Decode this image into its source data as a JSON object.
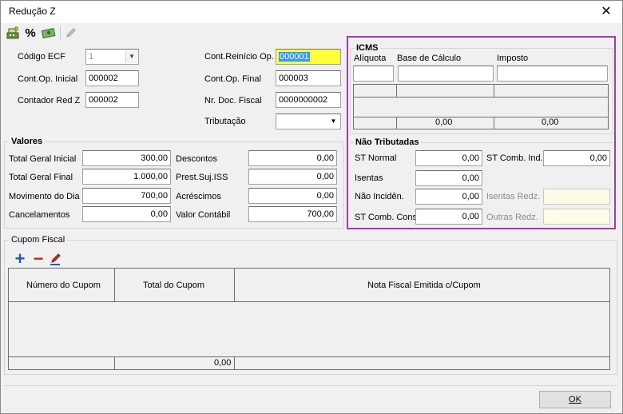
{
  "window": {
    "title": "Redução Z",
    "close_glyph": "✕"
  },
  "toolbar": {
    "icons": [
      "cash-register-icon",
      "percent-icon",
      "money-icon",
      "pencil-icon"
    ],
    "percent_glyph": "%"
  },
  "ecf": {
    "codigo_ecf_label": "Código ECF",
    "codigo_ecf_value": "1",
    "cont_op_inicial_label": "Cont.Op. Inicial",
    "cont_op_inicial_value": "000002",
    "contador_red_z_label": "Contador Red Z",
    "contador_red_z_value": "000002",
    "cont_reinicio_label": "Cont.Reinício Op.",
    "cont_reinicio_value": "000001",
    "cont_op_final_label": "Cont.Op. Final",
    "cont_op_final_value": "000003",
    "nr_doc_fiscal_label": "Nr. Doc. Fiscal",
    "nr_doc_fiscal_value": "0000000002",
    "tributacao_label": "Tributação",
    "tributacao_value": ""
  },
  "valores": {
    "title": "Valores",
    "total_geral_inicial_label": "Total Geral Inicial",
    "total_geral_inicial_value": "300,00",
    "total_geral_final_label": "Total Geral Final",
    "total_geral_final_value": "1.000,00",
    "movimento_dia_label": "Movimento do Dia",
    "movimento_dia_value": "700,00",
    "cancelamentos_label": "Cancelamentos",
    "cancelamentos_value": "0,00",
    "descontos_label": "Descontos",
    "descontos_value": "0,00",
    "prest_suj_iss_label": "Prest.Suj.ISS",
    "prest_suj_iss_value": "0,00",
    "acrescimos_label": "Acréscimos",
    "acrescimos_value": "0,00",
    "valor_contabil_label": "Valor Contábil",
    "valor_contabil_value": "700,00"
  },
  "icms": {
    "title": "ICMS",
    "aliquota_label": "Alíquota",
    "aliquota_value": "",
    "base_calculo_label": "Base de Cálculo",
    "base_calculo_value": "",
    "imposto_label": "Imposto",
    "imposto_value": "",
    "total_base": "0,00",
    "total_imposto": "0,00"
  },
  "nao_tributadas": {
    "title": "Não Tributadas",
    "st_normal_label": "ST Normal",
    "st_normal_value": "0,00",
    "isentas_label": "Isentas",
    "isentas_value": "0,00",
    "nao_incidencia_label": "Não Incidên.",
    "nao_incidencia_value": "0,00",
    "st_comb_cons_label": "ST Comb. Cons",
    "st_comb_cons_value": "0,00",
    "st_comb_ind_label": "ST Comb. Ind.",
    "st_comb_ind_value": "0,00",
    "isentas_redz_label": "Isentas Redz.",
    "isentas_redz_value": "",
    "outras_redz_label": "Outras Redz.",
    "outras_redz_value": ""
  },
  "cupom": {
    "title": "Cupom Fiscal",
    "columns": [
      "Número do Cupom",
      "Total do Cupom",
      "Nota Fiscal Emitida c/Cupom"
    ],
    "total": "0,00",
    "add_glyph": "+",
    "remove_glyph": "−"
  },
  "footer": {
    "ok_label": "OK"
  },
  "colors": {
    "highlight_border": "#9b3fa3",
    "yellow_field": "#ffff3c",
    "add_icon": "#1a56c9",
    "remove_icon": "#d11f1f"
  }
}
